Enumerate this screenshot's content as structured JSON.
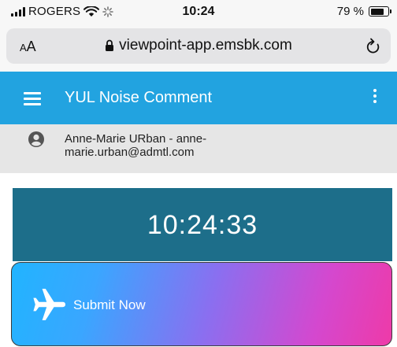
{
  "status_bar": {
    "carrier": "ROGERS",
    "time": "10:24",
    "battery_percent": "79 %",
    "battery_level": 0.79
  },
  "browser": {
    "text_size_label": "AA",
    "url": "viewpoint-app.emsbk.com",
    "icons": {
      "lock": "lock-icon",
      "reload": "reload-icon"
    }
  },
  "app_bar": {
    "title": "YUL Noise Comment",
    "icons": {
      "menu": "menu-icon",
      "more": "more-vertical-icon"
    },
    "color": "#22a3e0"
  },
  "user": {
    "label": "Anne-Marie URban - anne-marie.urban@admtl.com",
    "icon": "user-circle-icon"
  },
  "clock": {
    "time": "10:24:33",
    "color": "#1d6e8a"
  },
  "submit": {
    "label": "Submit Now",
    "icon": "airplane-icon",
    "gradient": [
      "#21b4ff",
      "#8a6ff0",
      "#ee3aa8"
    ]
  }
}
